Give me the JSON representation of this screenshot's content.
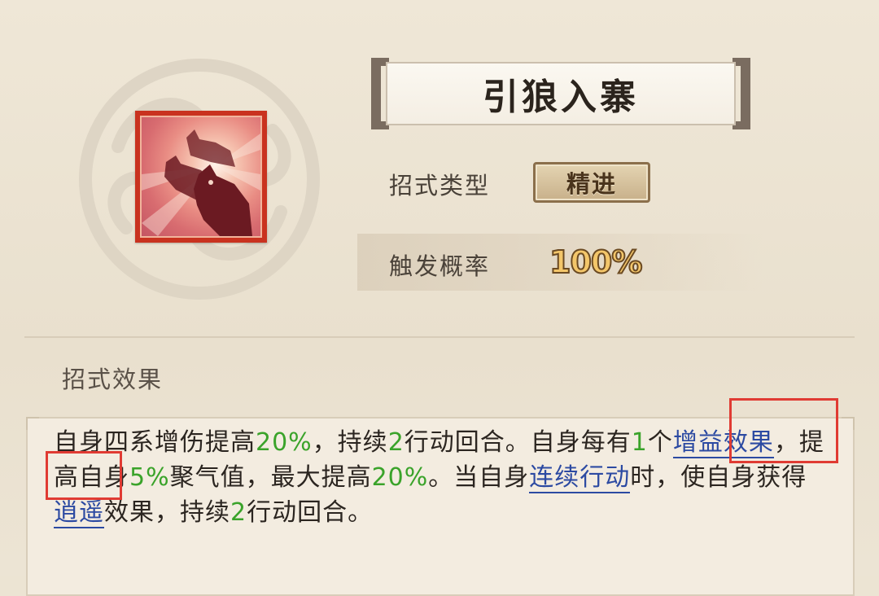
{
  "skill": {
    "name": "引狼入寨",
    "icon": "wolf-pack-icon",
    "type_label": "招式类型",
    "type_value": "精进",
    "prob_label": "触发概率",
    "prob_value": "100%"
  },
  "effect": {
    "section_title": "招式效果",
    "segments": [
      {
        "t": "自身四系增伤提高",
        "k": "text"
      },
      {
        "t": "20%",
        "k": "num"
      },
      {
        "t": "，持续",
        "k": "text"
      },
      {
        "t": "2",
        "k": "num"
      },
      {
        "t": "行动回合。自身每有",
        "k": "text"
      },
      {
        "t": "1",
        "k": "num"
      },
      {
        "t": "个",
        "k": "text"
      },
      {
        "t": "增益效果",
        "k": "kw"
      },
      {
        "t": "，提高自身",
        "k": "text"
      },
      {
        "t": "5%",
        "k": "num"
      },
      {
        "t": "聚气值，最大提高",
        "k": "text"
      },
      {
        "t": "20%",
        "k": "num"
      },
      {
        "t": "。当自身",
        "k": "text"
      },
      {
        "t": "连续行动",
        "k": "kw"
      },
      {
        "t": "时，使自身获得",
        "k": "text"
      },
      {
        "t": "逍遥",
        "k": "kw"
      },
      {
        "t": "效果，持续",
        "k": "text"
      },
      {
        "t": "2",
        "k": "num"
      },
      {
        "t": "行动回合。",
        "k": "text"
      }
    ]
  },
  "colors": {
    "number_green": "#3aa32a",
    "keyword_blue": "#2c4aa2",
    "highlight_red": "#e03b33",
    "icon_frame_red": "#c9321f"
  }
}
